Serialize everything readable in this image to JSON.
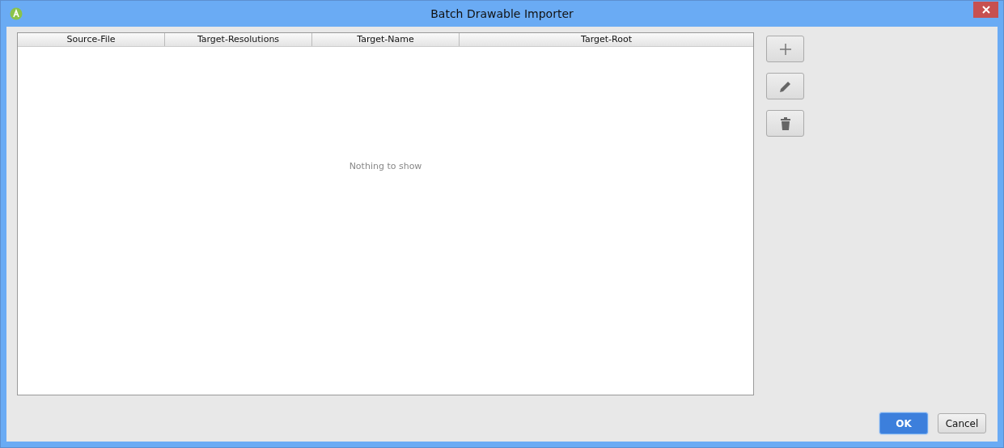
{
  "window": {
    "title": "Batch Drawable Importer"
  },
  "table": {
    "columns": [
      "Source-File",
      "Target-Resolutions",
      "Target-Name",
      "Target-Root"
    ],
    "empty_text": "Nothing to show"
  },
  "buttons": [
    {
      "label": "OK",
      "default": true
    },
    {
      "label": "Cancel",
      "default": false
    }
  ]
}
